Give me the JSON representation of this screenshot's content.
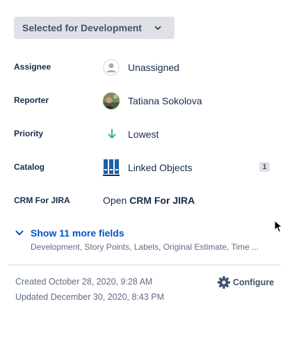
{
  "status": {
    "label": "Selected for Development"
  },
  "fields": {
    "assignee": {
      "label": "Assignee",
      "value": "Unassigned"
    },
    "reporter": {
      "label": "Reporter",
      "value": "Tatiana Sokolova"
    },
    "priority": {
      "label": "Priority",
      "value": "Lowest",
      "color": "#36b37e"
    },
    "catalog": {
      "label": "Catalog",
      "value": "Linked Objects",
      "count": "1"
    },
    "crm": {
      "label": "CRM For JIRA",
      "value_prefix": "Open",
      "value_bold": "CRM For JIRA"
    }
  },
  "more_fields": {
    "label": "Show 11 more fields",
    "summary": "Development, Story Points, Labels, Original Estimate, Time ..."
  },
  "meta": {
    "created": "Created October 28, 2020, 9:28 AM",
    "updated": "Updated December 30, 2020, 8:43 PM",
    "configure_label": "Configure"
  },
  "colors": {
    "link": "#0052cc",
    "text": "#172b4d",
    "muted": "#5e6c84"
  },
  "icons": [
    "chevron-down-icon",
    "user-placeholder-icon",
    "arrow-down-icon",
    "catalog-icon",
    "gear-icon",
    "cursor-icon"
  ]
}
